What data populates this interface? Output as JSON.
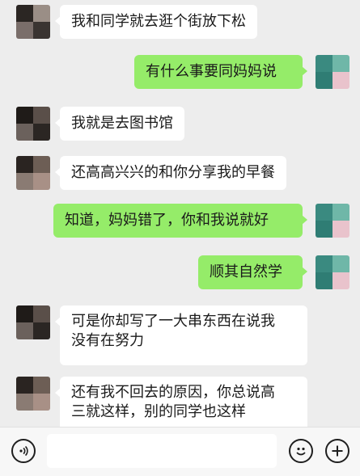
{
  "messages": [
    {
      "side": "left",
      "text": "我和同学就去逛个街放下松"
    },
    {
      "side": "right",
      "text": "有什么事要同妈妈说"
    },
    {
      "side": "left",
      "text": "我就是去图书馆"
    },
    {
      "side": "left",
      "text": "还高高兴兴的和你分享我的早餐"
    },
    {
      "side": "right",
      "text": "知道，妈妈错了，你和我说就好"
    },
    {
      "side": "right",
      "text": "顺其自然学"
    },
    {
      "side": "left",
      "lines": [
        "可是你却写了一大串东西在说我",
        "没有在努力"
      ]
    },
    {
      "side": "left",
      "lines": [
        "还有我不回去的原因，你总说高",
        "三就这样，别的同学也这样"
      ]
    }
  ],
  "toolbar": {
    "voice_icon": "voice-icon",
    "emoji_icon": "emoji-icon",
    "add_icon": "plus-icon",
    "input_value": ""
  },
  "colors": {
    "background": "#ededed",
    "sent_bubble": "#95ec69",
    "received_bubble": "#ffffff"
  }
}
